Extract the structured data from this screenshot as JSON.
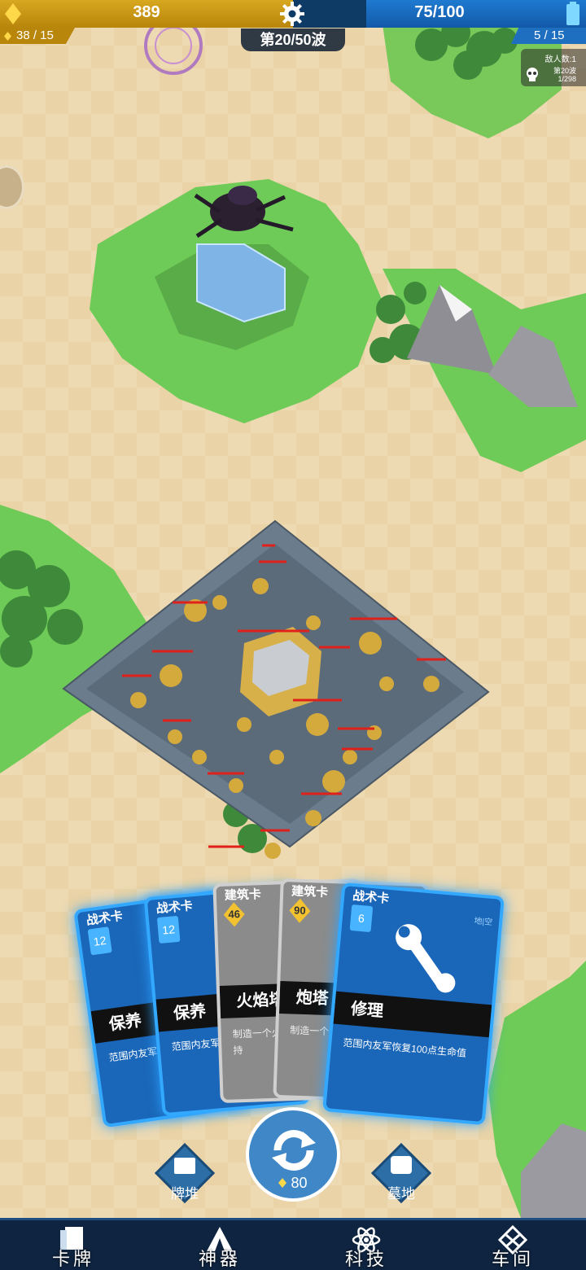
{
  "hud": {
    "gold": "389",
    "energy": "75/100",
    "gold_income": "38 / 15",
    "energy_regen": "5 / 15",
    "wave": "第20/50波",
    "enemy_count": "敌人数:1",
    "enemy_wave": "第20波",
    "enemy_progress": "1/298",
    "colors": {
      "gold": "#c9960f",
      "energy": "#1f6fc0"
    }
  },
  "cards": [
    {
      "type": "战术卡",
      "cost": "12",
      "name": "保养",
      "desc": "范围内友军恢复生命值，持"
    },
    {
      "type": "战术卡",
      "cost": "12",
      "name": "保养",
      "desc": "范围内友军恢复生命值，持"
    },
    {
      "type": "建筑卡",
      "cost": "46",
      "name": "火焰塔",
      "desc": "制造一个火焰喷射塔并造成持"
    },
    {
      "type": "建筑卡",
      "cost": "90",
      "name": "炮塔",
      "desc": "制造一个炮塔攻击地面目"
    },
    {
      "type": "战术卡",
      "cost": "6",
      "name": "修理",
      "desc": "范围内友军恢复100点生命值",
      "tags": "地|空"
    }
  ],
  "controls": {
    "deck": "牌堆",
    "graveyard": "墓地",
    "refresh_cost": "80"
  },
  "nav": [
    {
      "label": "卡牌",
      "icon": "cards-icon"
    },
    {
      "label": "神器",
      "icon": "tent-icon"
    },
    {
      "label": "科技",
      "icon": "atom-icon"
    },
    {
      "label": "车间",
      "icon": "workshop-icon"
    }
  ]
}
